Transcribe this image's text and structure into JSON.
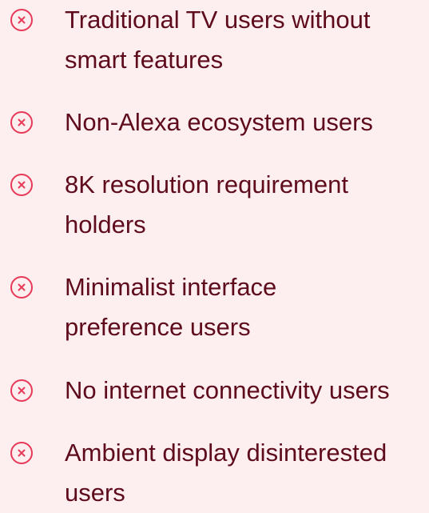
{
  "list": {
    "icon_name": "close-circle-icon",
    "icon_color": "#e63a58",
    "text_color": "#5e0b1c",
    "background": "#fdeef0",
    "items": [
      {
        "label": "Traditional TV users without smart features"
      },
      {
        "label": "Non-Alexa ecosystem users"
      },
      {
        "label": "8K resolution requirement holders"
      },
      {
        "label": "Minimalist interface preference users"
      },
      {
        "label": "No internet connectivity users"
      },
      {
        "label": "Ambient display disinterested users"
      }
    ]
  }
}
